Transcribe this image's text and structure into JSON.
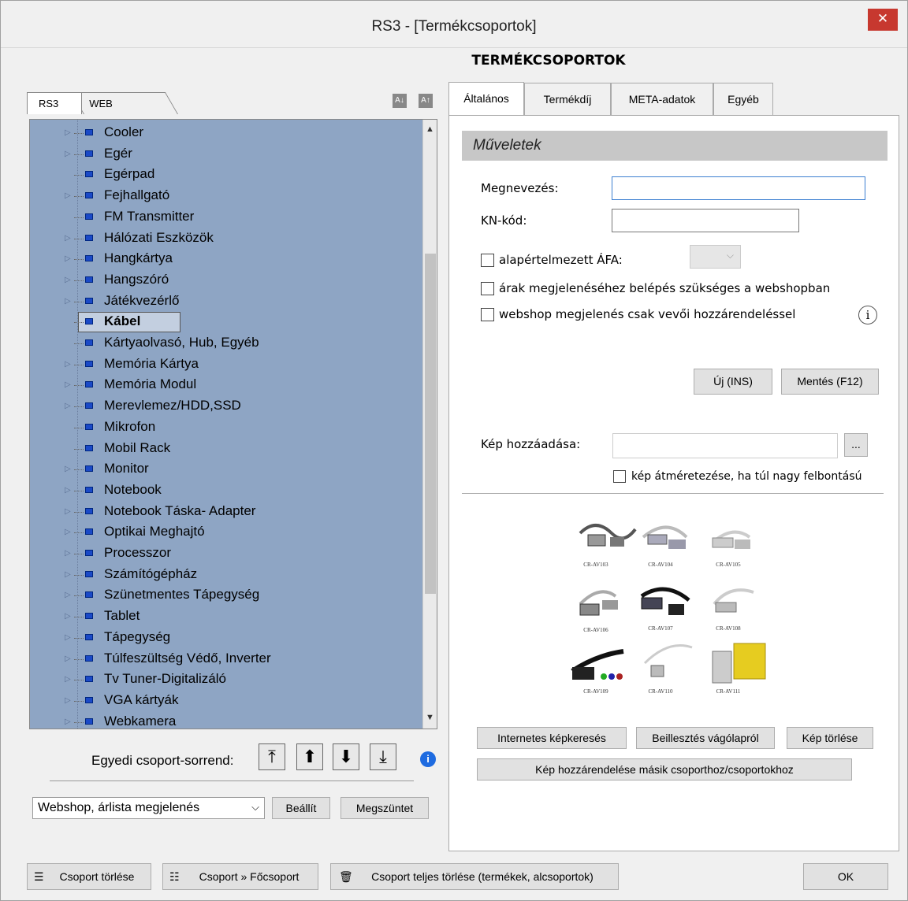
{
  "window": {
    "title": "RS3 - [Termékcsoportok]",
    "close": "✕"
  },
  "heading": "TERMÉKCSOPORTOK",
  "left_tabs": [
    "RS3",
    "WEB"
  ],
  "tree": {
    "items": [
      "Cooler",
      "Egér",
      "Egérpad",
      "Fejhallgató",
      "FM Transmitter",
      "Hálózati Eszközök",
      "Hangkártya",
      "Hangszóró",
      "Játékvezérlő",
      "Kábel",
      "Kártyaolvasó, Hub, Egyéb",
      "Memória Kártya",
      "Memória Modul",
      "Merevlemez/HDD,SSD",
      "Mikrofon",
      "Mobil Rack",
      "Monitor",
      "Notebook",
      "Notebook Táska- Adapter",
      "Optikai Meghajtó",
      "Processzor",
      "Számítógépház",
      "Szünetmentes Tápegység",
      "Tablet",
      "Tápegység",
      "Túlfeszültség Védő, Inverter",
      "Tv Tuner-Digitalizáló",
      "VGA kártyák",
      "Webkamera"
    ],
    "selected": "Kábel"
  },
  "order": {
    "label": "Egyedi csoport-sorrend:"
  },
  "display_select": {
    "value": "Webshop, árlista megjelenés"
  },
  "left_buttons": {
    "set": "Beállít",
    "remove": "Megszüntet"
  },
  "right_tabs": [
    "Általános",
    "Termékdíj",
    "META-adatok",
    "Egyéb"
  ],
  "section": "Műveletek",
  "form": {
    "name_label": "Megnevezés:",
    "name_value": "",
    "kn_label": "KN-kód:",
    "kn_value": "",
    "vat_label": "alapértelmezett ÁFA:",
    "login_label": "árak megjelenéséhez belépés szükséges a webshopban",
    "webshop_label": "webshop megjelenés csak vevői hozzárendeléssel",
    "new_btn": "Új (INS)",
    "save_btn": "Mentés (F12)"
  },
  "image": {
    "add_label": "Kép hozzáadása:",
    "browse": "...",
    "resize_label": "kép átméretezése, ha túl nagy felbontású",
    "captions": [
      "CR-AV103",
      "CR-AV104",
      "CR-AV105",
      "CR-AV106",
      "CR-AV107",
      "CR-AV108",
      "CR-AV109",
      "CR-AV110",
      "CR-AV111"
    ],
    "search_btn": "Internetes képkeresés",
    "paste_btn": "Beillesztés vágólapról",
    "delete_btn": "Kép törlése",
    "assign_btn": "Kép hozzárendelése másik csoporthoz/csoportokhoz"
  },
  "bottom": {
    "delete_group": "Csoport törlése",
    "to_main": "Csoport » Főcsoport",
    "full_delete": "Csoport teljes törlése (termékek, alcsoportok)",
    "ok": "OK"
  }
}
